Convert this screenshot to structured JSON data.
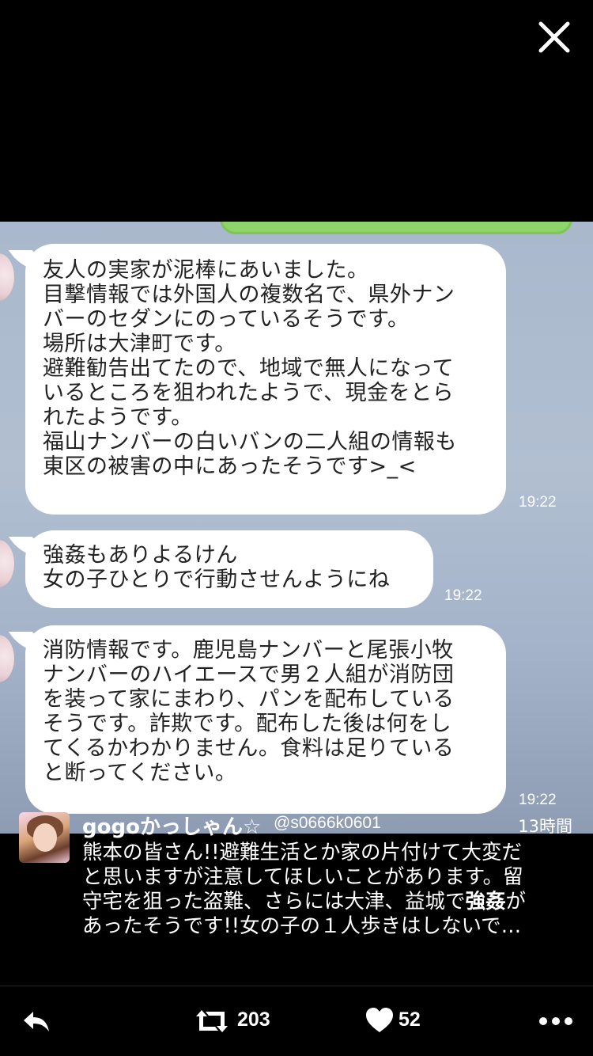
{
  "chat": {
    "messages": [
      {
        "lines": [
          "友人の実家が泥棒にあいました。",
          "目撃情報では外国人の複数名で、県外ナン",
          "バーのセダンにのっているそうです。",
          "場所は大津町です。",
          "避難勧告出てたので、地域で無人になって",
          "いるところを狙われたようで、現金をとら",
          "れたようです。",
          "福山ナンバーの白いバンの二人組の情報も",
          "東区の被害の中にあったそうです>_<"
        ],
        "time": "19:22"
      },
      {
        "lines": [
          "強姦もありよるけん",
          "女の子ひとりで行動させんようにね"
        ],
        "time": "19:22"
      },
      {
        "lines": [
          "消防情報です。鹿児島ナンバーと尾張小牧",
          "ナンバーのハイエースで男２人組が消防団",
          "を装って家にまわり、パンを配布している",
          "そうです。詐欺です。配布した後は何をし",
          "てくるかわかりません。食料は足りている",
          "と断ってください。"
        ],
        "time": "19:22"
      }
    ]
  },
  "tweet": {
    "name": "gogoかっしゃん☆",
    "handle": "@s0666k0601",
    "time": "13時間",
    "lines": [
      {
        "pre": "熊本の皆さん!!避難生活とか家の片付けて大変だ",
        "bold": "",
        "post": ""
      },
      {
        "pre": "と思いますが注意してほしいことがあります。留",
        "bold": "",
        "post": ""
      },
      {
        "pre": "守宅を狙った盗難、さらには大津、益城で",
        "bold": "強姦",
        "post": "が"
      },
      {
        "pre": "あったそうです!!女の子の１人歩きはしないで…",
        "bold": "",
        "post": ""
      }
    ]
  },
  "actions": {
    "retweet_count": "203",
    "like_count": "52"
  },
  "icons": {
    "close": "close-icon",
    "reply": "reply-icon",
    "retweet": "retweet-icon",
    "like": "heart-icon",
    "more": "more-icon"
  },
  "colors": {
    "background": "#000000",
    "bubble": "#ffffff",
    "chat_bg": "#aab8cc",
    "outgoing_bubble": "#8fd46a"
  }
}
